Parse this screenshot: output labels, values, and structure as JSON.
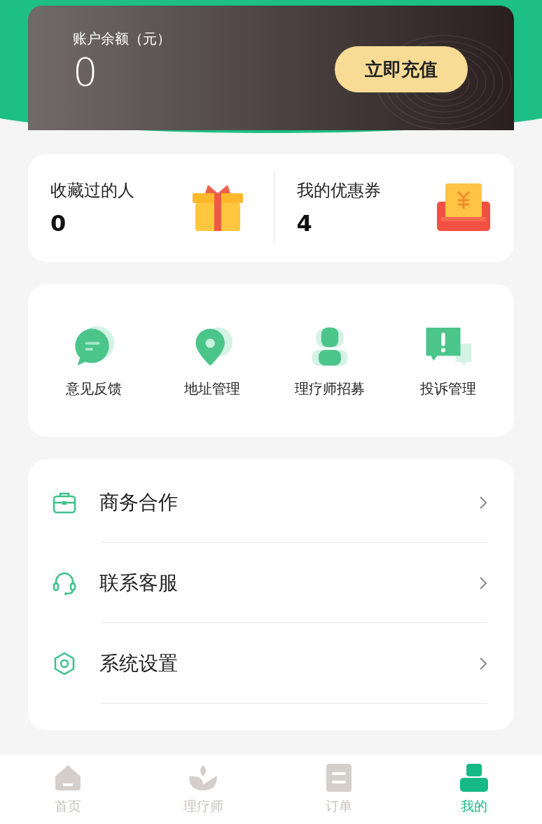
{
  "balance": {
    "label": "账户余额（元）",
    "amount": "0",
    "recharge_button": "立即充值"
  },
  "stats": [
    {
      "label": "收藏过的人",
      "value": "0"
    },
    {
      "label": "我的优惠券",
      "value": "4"
    }
  ],
  "shortcuts": [
    {
      "label": "意见反馈"
    },
    {
      "label": "地址管理"
    },
    {
      "label": "理疗师招募"
    },
    {
      "label": "投诉管理"
    }
  ],
  "menu": [
    {
      "label": "商务合作"
    },
    {
      "label": "联系客服"
    },
    {
      "label": "系统设置"
    }
  ],
  "tab_bar": [
    {
      "label": "首页",
      "selected": false
    },
    {
      "label": "理疗师",
      "selected": false
    },
    {
      "label": "订单",
      "selected": false
    },
    {
      "label": "我的",
      "selected": true
    }
  ]
}
